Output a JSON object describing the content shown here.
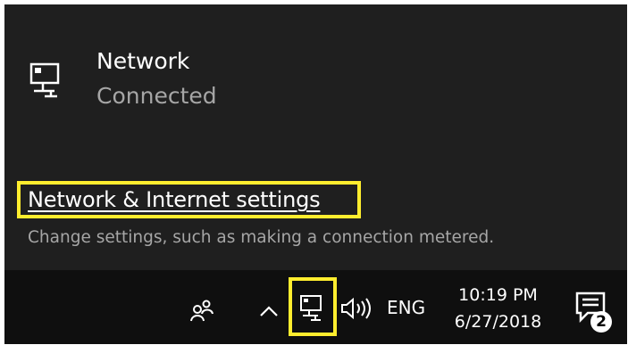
{
  "network": {
    "name": "Network",
    "status": "Connected",
    "icon": "ethernet-monitor-icon"
  },
  "settings": {
    "link_label": "Network & Internet settings",
    "description": "Change settings, such as making a connection metered."
  },
  "taskbar": {
    "people_icon": "people-icon",
    "chevron_icon": "chevron-up-icon",
    "network_icon": "network-icon",
    "volume_icon": "volume-icon",
    "language": "ENG",
    "time": "10:19 PM",
    "date": "6/27/2018",
    "action_center_icon": "action-center-icon",
    "notification_count": "2"
  },
  "colors": {
    "flyout_background": "#1f1f1f",
    "taskbar_background": "#0f0f0f",
    "highlight": "#ffed2e",
    "secondary_text": "#a6a6a6"
  }
}
